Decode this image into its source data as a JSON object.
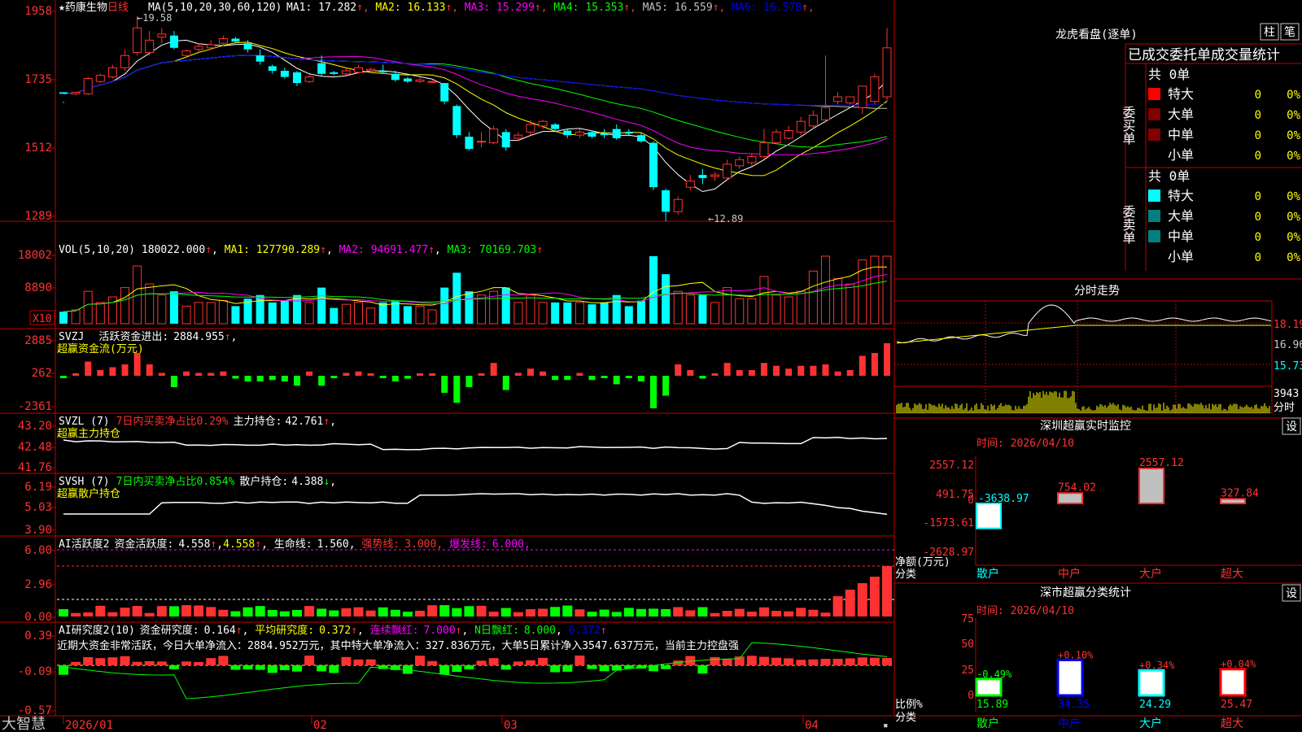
{
  "app": {
    "footer_brand": "大智慧"
  },
  "stock": {
    "star": "★",
    "name": "药康生物",
    "period": "日线"
  },
  "colors": {
    "up": "#ff3232",
    "down": "#00ffff",
    "frame": "#c00000",
    "ma1": "#ffffff",
    "ma2": "#ffff00",
    "ma3": "#ff00ff",
    "ma4": "#00ff00",
    "ma5": "#c0c0c0",
    "ma6": "#0000ff"
  },
  "main_panel": {
    "header_ma_label": "MA(5,10,20,30,60,120)",
    "ma_values": [
      {
        "name": "MA1",
        "value": "17.282",
        "arrow": "↑",
        "color": "#ffffff"
      },
      {
        "name": "MA2",
        "value": "16.133",
        "arrow": "↑",
        "color": "#ffff00"
      },
      {
        "name": "MA3",
        "value": "15.299",
        "arrow": "↑",
        "color": "#ff00ff"
      },
      {
        "name": "MA4",
        "value": "15.353",
        "arrow": "↑",
        "color": "#00ff00"
      },
      {
        "name": "MA5",
        "value": "16.559",
        "arrow": "↑",
        "color": "#c0c0c0"
      },
      {
        "name": "MA6",
        "value": "16.578",
        "arrow": "↑",
        "color": "#0000ff"
      }
    ],
    "y_ticks": [
      "1958",
      "1735",
      "1512",
      "1289"
    ],
    "high_label": "19.58",
    "low_label": "12.89"
  },
  "vol_panel": {
    "label": "VOL(5,10,20)",
    "value": "180022.000",
    "ma1": "127790.289",
    "ma2": "94691.477",
    "ma3": "70169.703",
    "y_ticks": [
      "18002",
      "8890"
    ],
    "unit": "X10"
  },
  "svzj_panel": {
    "label": "SVZJ",
    "title": "活跃资金进出:",
    "value": "2884.955",
    "subtitle": "超赢资金流(万元)",
    "y_ticks": [
      "2885",
      "262",
      "-2361"
    ]
  },
  "svzl_panel": {
    "label": "SVZL (7)",
    "desc": "7日内买卖净占比0.29%",
    "hold_label": "主力持仓:",
    "hold_value": "42.761",
    "subtitle": "超赢主力持仓",
    "y_ticks": [
      "43.20",
      "42.48",
      "41.76"
    ]
  },
  "svsh_panel": {
    "label": "SVSH (7)",
    "desc": "7日内买卖净占比0.854%",
    "hold_label": "散户持仓:",
    "hold_value": "4.388",
    "subtitle": "超赢散户持仓",
    "y_ticks": [
      "6.19",
      "5.03",
      "3.90"
    ]
  },
  "ai1_panel": {
    "label": "AI活跃度2",
    "activity_label": "资金活跃度:",
    "activity_value": "4.558",
    "second_value": "4.558",
    "life_label": "生命线:",
    "life_value": "1.560",
    "strong_label": "强势线:",
    "strong_value": "3.000",
    "burst_label": "爆发线:",
    "burst_value": "6.000",
    "y_ticks": [
      "6.00",
      "2.96",
      "0.00"
    ]
  },
  "ai2_panel": {
    "label": "AI研究度2(10)",
    "research_label": "资金研究度:",
    "research_value": "0.164",
    "avg_label": "平均研究度:",
    "avg_value": "0.372",
    "red_label": "连续飘红:",
    "red_value": "7.000",
    "n_label": "N日飘红:",
    "n_value": "8.000",
    "extra_value": "0.372",
    "commentary": "近期大资金非常活跃，今日大单净流入：2884.952万元，其中特大单净流入：327.836万元，大单5日累计净入3547.637万元，当前主力控盘强",
    "y_ticks": [
      "0.39",
      "-0.09",
      "-0.57"
    ]
  },
  "x_axis": [
    "2026/01",
    "02",
    "03",
    "04"
  ],
  "lhb": {
    "title": "龙虎看盘(逐单)",
    "btn1": "柱",
    "btn2": "笔",
    "table_title": "已成交委托单成交量统计",
    "buy_label": "委买单",
    "sell_label": "委卖单",
    "buy_total": "共 0单",
    "sell_total": "共 0单",
    "rows": [
      {
        "name": "特大",
        "count": "0",
        "pct": "0%"
      },
      {
        "name": "大单",
        "count": "0",
        "pct": "0%"
      },
      {
        "name": "中单",
        "count": "0",
        "pct": "0%"
      },
      {
        "name": "小单",
        "count": "0",
        "pct": "0%"
      }
    ],
    "buy_colors": [
      "#ff0000",
      "#800000",
      "#800000",
      "#000000"
    ],
    "sell_colors": [
      "#00ffff",
      "#008080",
      "#008080",
      "#000000"
    ]
  },
  "intraday": {
    "title": "分时走势",
    "prices": [
      "18.19",
      "16.96",
      "15.73"
    ],
    "vol_top": "3943",
    "vol_unit": "分时"
  },
  "sz_monitor": {
    "title": "深圳超赢实时监控",
    "btn": "设",
    "time": "时间: 2026/04/10",
    "y_ticks": [
      "2557.12",
      "491.75",
      "0",
      "-1573.61",
      "-2628.97"
    ],
    "ylabel": "净额(万元)",
    "xlabel": "分类",
    "bars": [
      {
        "name": "散户",
        "value": -3638.97,
        "label": "-3638.97"
      },
      {
        "name": "中户",
        "value": 754.02,
        "label": "754.02"
      },
      {
        "name": "大户",
        "value": 2557.12,
        "label": "2557.12"
      },
      {
        "name": "超大",
        "value": 327.84,
        "label": "327.84"
      }
    ]
  },
  "sz_class": {
    "title": "深市超赢分类统计",
    "btn": "设",
    "time": "时间: 2026/04/10",
    "y_ticks": [
      "75",
      "50",
      "25",
      "0"
    ],
    "ylabel": "比例%",
    "xlabel": "分类",
    "bars": [
      {
        "name": "散户",
        "value": 15.89,
        "label": "15.89",
        "chg": "-0.49%"
      },
      {
        "name": "中户",
        "value": 34.35,
        "label": "34.35",
        "chg": "+0.10%"
      },
      {
        "name": "大户",
        "value": 24.29,
        "label": "24.29",
        "chg": "+0.34%"
      },
      {
        "name": "超大",
        "value": 25.47,
        "label": "25.47",
        "chg": "+0.04%"
      }
    ]
  },
  "chart_data": {
    "type": "candlestick",
    "y_range": [
      12.89,
      19.58
    ],
    "candles": [
      [
        17.1,
        17.05,
        16.8,
        16.75,
        16.75
      ],
      [
        17.05,
        17.1,
        17.1,
        17.0,
        17.0
      ],
      [
        17.05,
        17.55,
        17.6,
        17.0,
        17.0
      ],
      [
        17.45,
        17.65,
        17.7,
        17.4,
        17.4
      ],
      [
        17.6,
        17.9,
        18.0,
        17.55,
        17.55
      ],
      [
        17.9,
        18.3,
        18.5,
        17.8,
        17.8
      ],
      [
        18.4,
        19.2,
        19.58,
        18.3,
        18.3
      ],
      [
        18.4,
        18.8,
        19.1,
        18.3,
        18.3
      ],
      [
        18.9,
        19.0,
        19.2,
        18.7,
        18.7
      ],
      [
        18.95,
        18.55,
        19.1,
        18.5,
        18.5
      ],
      [
        18.3,
        18.45,
        18.5,
        18.3,
        18.3
      ],
      [
        18.5,
        18.6,
        18.7,
        18.4,
        18.4
      ],
      [
        18.55,
        18.65,
        18.8,
        18.5,
        18.5
      ],
      [
        18.7,
        18.85,
        18.95,
        18.6,
        18.6
      ],
      [
        18.85,
        18.75,
        18.9,
        18.7,
        18.7
      ],
      [
        18.7,
        18.5,
        18.8,
        18.4,
        18.4
      ],
      [
        18.3,
        18.1,
        18.5,
        18.0,
        18.0
      ],
      [
        17.95,
        17.8,
        18.0,
        17.7,
        17.7
      ],
      [
        17.8,
        17.6,
        17.9,
        17.55,
        17.55
      ],
      [
        17.75,
        17.4,
        17.8,
        17.3,
        17.3
      ],
      [
        17.45,
        17.6,
        17.7,
        17.4,
        17.4
      ],
      [
        18.05,
        17.7,
        18.3,
        17.6,
        17.6
      ],
      [
        17.75,
        17.7,
        17.8,
        17.65,
        17.65
      ],
      [
        17.7,
        17.8,
        17.9,
        17.65,
        17.65
      ],
      [
        17.75,
        17.9,
        18.0,
        17.7,
        17.7
      ],
      [
        17.8,
        17.85,
        17.9,
        17.75,
        17.75
      ],
      [
        17.8,
        17.75,
        18.0,
        17.7,
        17.7
      ],
      [
        17.7,
        17.5,
        17.8,
        17.45,
        17.45
      ],
      [
        17.55,
        17.45,
        17.6,
        17.4,
        17.4
      ],
      [
        17.45,
        17.5,
        17.6,
        17.4,
        17.4
      ],
      [
        17.45,
        17.45,
        17.5,
        17.4,
        17.4
      ],
      [
        17.4,
        16.8,
        17.4,
        16.7,
        16.7
      ],
      [
        16.65,
        15.7,
        16.7,
        15.6,
        15.6
      ],
      [
        15.65,
        15.25,
        15.8,
        15.2,
        15.2
      ],
      [
        15.5,
        15.5,
        15.8,
        15.3,
        15.3
      ],
      [
        15.45,
        15.9,
        16.0,
        15.4,
        15.4
      ],
      [
        15.8,
        15.3,
        15.9,
        15.2,
        15.2
      ],
      [
        15.6,
        15.7,
        15.8,
        15.5,
        15.5
      ],
      [
        15.8,
        16.05,
        16.2,
        15.7,
        15.7
      ],
      [
        16.0,
        16.15,
        16.2,
        15.9,
        15.9
      ],
      [
        16.05,
        15.9,
        16.1,
        15.8,
        15.8
      ],
      [
        15.85,
        15.7,
        15.9,
        15.6,
        15.6
      ],
      [
        15.7,
        15.8,
        15.9,
        15.6,
        15.6
      ],
      [
        15.8,
        15.65,
        15.85,
        15.6,
        15.6
      ],
      [
        15.75,
        15.7,
        15.9,
        15.6,
        15.6
      ],
      [
        15.9,
        15.6,
        16.05,
        15.55,
        15.55
      ],
      [
        15.8,
        15.75,
        15.9,
        15.7,
        15.7
      ],
      [
        15.7,
        15.5,
        15.8,
        15.45,
        15.45
      ],
      [
        15.45,
        14.0,
        15.5,
        13.9,
        13.9
      ],
      [
        13.9,
        13.2,
        13.95,
        12.89,
        12.89
      ],
      [
        13.2,
        13.6,
        13.7,
        13.1,
        13.1
      ],
      [
        14.0,
        14.2,
        14.4,
        13.9,
        13.9
      ],
      [
        14.4,
        14.3,
        14.6,
        14.1,
        14.1
      ],
      [
        14.35,
        14.4,
        14.5,
        14.2,
        14.2
      ],
      [
        14.3,
        14.75,
        14.9,
        14.2,
        14.2
      ],
      [
        14.7,
        14.9,
        15.0,
        14.6,
        14.6
      ],
      [
        14.8,
        15.0,
        15.1,
        14.7,
        14.7
      ],
      [
        15.0,
        15.45,
        15.9,
        14.9,
        14.9
      ],
      [
        15.45,
        15.8,
        15.9,
        15.4,
        15.4
      ],
      [
        15.6,
        15.85,
        16.0,
        15.55,
        15.55
      ],
      [
        15.8,
        16.15,
        16.3,
        15.7,
        15.7
      ],
      [
        16.0,
        16.35,
        16.5,
        15.9,
        15.9
      ],
      [
        16.2,
        16.6,
        18.3,
        16.1,
        16.1
      ],
      [
        16.8,
        16.95,
        17.1,
        16.7,
        16.7
      ],
      [
        16.75,
        16.95,
        16.95,
        16.7,
        16.7
      ],
      [
        16.6,
        17.3,
        17.3,
        16.4,
        16.4
      ],
      [
        16.8,
        17.6,
        17.7,
        16.7,
        16.7
      ],
      [
        16.95,
        18.55,
        19.2,
        16.8,
        16.8
      ]
    ]
  }
}
